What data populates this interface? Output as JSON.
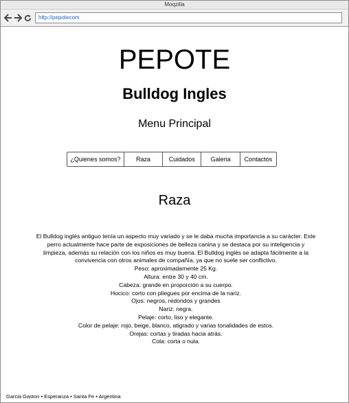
{
  "browser": {
    "window_title": "Moqzilla",
    "url": "http://pepotecom"
  },
  "page": {
    "site_title": "PEPOTE",
    "breed_title": "Bulldog Ingles",
    "menu_title": "Menu Principal",
    "nav": [
      {
        "label": "¿Quienes somos?"
      },
      {
        "label": "Raza"
      },
      {
        "label": "Cuidados"
      },
      {
        "label": "Galeria"
      },
      {
        "label": "Contactos"
      }
    ],
    "section_title": "Raza",
    "intro": "El Bulldog inglés antiguo tenía un aspecto muy variado y se le daba mucha importancia a su carácter. Este perro actualmente hace parte de exposiciones de belleza canina y se destaca por su inteligencia y limpieza, además su relación con los niños es muy buena. El Bulldog inglés se adapta fácilmente a la convivencia con otros animales de compañía, ya que no suele ser conflictivo.",
    "features": [
      "Peso: aproximadamente 25 Kg.",
      "Altura: entre 30 y 40 cm.",
      "Cabeza: grande en proporción a su cuerpo.",
      "Hocico: corto con pliegues por encima de la nariz.",
      "Ojos: negros, redondos y grandes",
      "Nariz: negra.",
      "Pelaje: corto, liso y elegante.",
      "Color de pelaje: rojo, beige, blanco, atigrado y varias tonalidades de estos.",
      "Orejas: cortas y tiradas hacia atrás.",
      "Cola: corta o nula."
    ],
    "footer": "Garcia Gaston • Esperanza • Santa Fe • Argentina"
  }
}
